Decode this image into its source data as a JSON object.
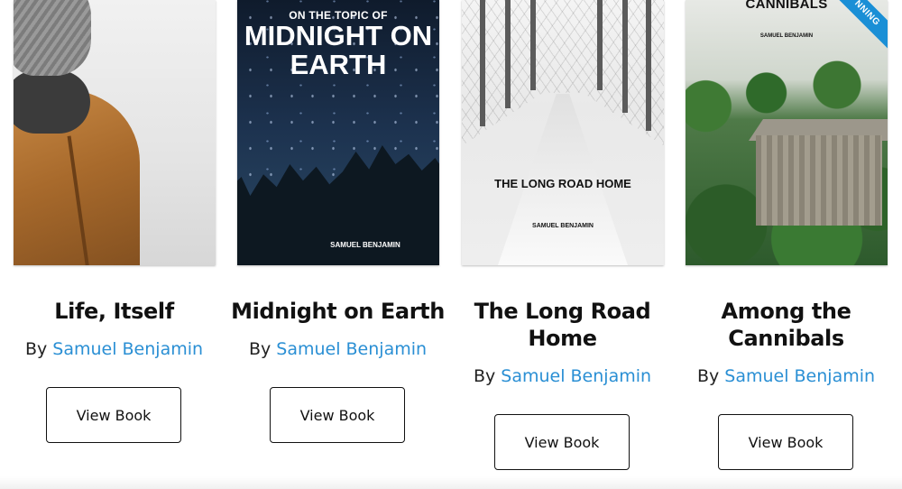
{
  "books": [
    {
      "title": "Life, Itself",
      "by_prefix": "By",
      "author": "Samuel Benjamin",
      "button_label": "View Book",
      "cover": {
        "style": "person-in-fog"
      }
    },
    {
      "title": "Midnight on Earth",
      "by_prefix": "By",
      "author": "Samuel Benjamin",
      "button_label": "View Book",
      "cover": {
        "style": "night-sky",
        "kicker": "ON THE TOPIC OF",
        "title": "MIDNIGHT ON EARTH",
        "author": "SAMUEL BENJAMIN"
      }
    },
    {
      "title": "The Long Road Home",
      "by_prefix": "By",
      "author": "Samuel Benjamin",
      "button_label": "View Book",
      "cover": {
        "style": "snowy-road",
        "title": "THE LONG ROAD HOME",
        "author": "SAMUEL BENJAMIN"
      }
    },
    {
      "title": "Among the Cannibals",
      "by_prefix": "By",
      "author": "Samuel Benjamin",
      "button_label": "View Book",
      "cover": {
        "style": "jungle-house",
        "title": "CANNIBALS",
        "author": "SAMUEL BENJAMIN",
        "ribbon": "NNING"
      }
    }
  ],
  "colors": {
    "author_link": "#2a8fd4",
    "ribbon": "#1a8fd6",
    "button_border": "#111111"
  }
}
